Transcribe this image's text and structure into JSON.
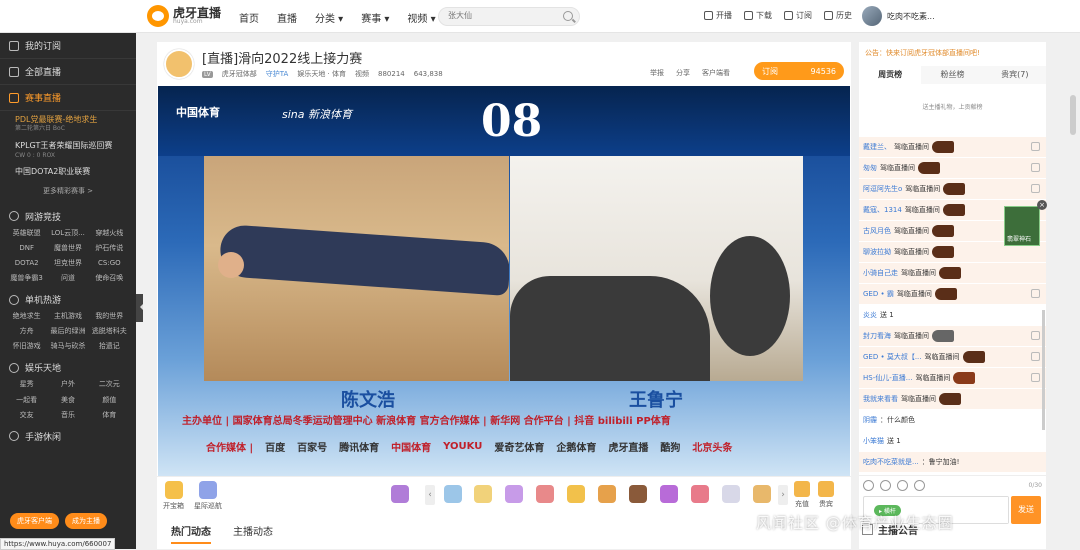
{
  "header": {
    "logo_cn": "虎牙直播",
    "logo_en": "huya.com",
    "nav": [
      "首页",
      "直播",
      "分类 ▾",
      "赛事 ▾",
      "视频 ▾"
    ],
    "search_placeholder": "张大仙",
    "tools": [
      "开播",
      "下载",
      "订阅",
      "历史"
    ],
    "username": "吃肉不吃素..."
  },
  "sidebar": {
    "items": [
      "我的订阅",
      "全部直播",
      "赛事直播"
    ],
    "matches": [
      {
        "title": "PDL党最联赛-绝地求生",
        "sub": "第二轮第六日 BoC"
      },
      {
        "title": "KPLGT王者荣耀国际巡回赛",
        "sub": "CW 0 : 0 ROX"
      },
      {
        "title": "中国DOTA2职业联赛",
        "sub": ""
      }
    ],
    "more": "更多精彩赛事 >",
    "sections": [
      {
        "title": "网游竞技",
        "games": [
          "英雄联盟",
          "LOL云顶...",
          "穿越火线",
          "DNF",
          "魔兽世界",
          "炉石传说",
          "DOTA2",
          "坦克世界",
          "CS:GO",
          "魔兽争霸3",
          "问道",
          "使命召唤"
        ]
      },
      {
        "title": "单机热游",
        "games": [
          "绝地求生",
          "主机游戏",
          "我的世界",
          "方舟",
          "最后的绿洲",
          "逃脱塔科夫",
          "怀旧游戏",
          "骑马与砍杀",
          "拾遗记"
        ]
      },
      {
        "title": "娱乐天地",
        "games": [
          "星秀",
          "户外",
          "二次元",
          "一起看",
          "美食",
          "颜值",
          "交友",
          "音乐",
          "体育"
        ]
      },
      {
        "title": "手游休闲",
        "games": []
      }
    ],
    "buttons": [
      "虎牙客户端",
      "成为主播"
    ],
    "status_url": "https://www.huya.com/660007"
  },
  "room": {
    "title": "[直播]滑向2022线上接力赛",
    "level": "LV",
    "anchor": "虎牙冠体部",
    "anchor_tag": "守护TA",
    "category": "娱乐天地 · 体育",
    "video": "视频",
    "room_id": "880214",
    "viewers": "643,838",
    "actions": [
      "举报",
      "分享",
      "客户端看"
    ],
    "subscribe_label": "订阅",
    "subscribe_count": "94536"
  },
  "stream": {
    "brand1": "中国体育",
    "brand2": "sina 新浪体育",
    "number": "08",
    "name_left": "陈文浩",
    "name_right": "王鲁宁",
    "org_line": "主办单位 | 国家体育总局冬季运动管理中心 新浪体育 官方合作媒体 | 新华网 合作平台 | 抖音 bilibili PP体育",
    "media_line": [
      "合作媒体 |",
      "百度",
      "百家号",
      "腾讯体育",
      "中国体育",
      "YOUKU",
      "爱奇艺体育",
      "企鹅体育",
      "虎牙直播",
      "酷狗",
      "北京头条"
    ]
  },
  "giftbar": {
    "left": [
      "开宝箱",
      "星际巡航"
    ],
    "right": [
      "充值",
      "贵宾"
    ]
  },
  "tabs": [
    "热门动态",
    "主播动态"
  ],
  "chat": {
    "notice": "公告：快来订阅虎牙冠体部直播间吧!",
    "tabs": [
      "周贡榜",
      "粉丝榜",
      "贵宾(7)"
    ],
    "empty": "送主播礼物，上贡献榜",
    "messages": [
      {
        "user": "戴建兰、",
        "text": "驾临直播间"
      },
      {
        "user": "匆匆",
        "text": "驾临直播间"
      },
      {
        "user": "阿逗阿先生o",
        "text": "驾临直播间"
      },
      {
        "user": "戴寇、1314",
        "text": "驾临直播间"
      },
      {
        "user": "古风月色",
        "text": "驾临直播间"
      },
      {
        "user": "聊波拉拗",
        "text": "驾临直播间"
      },
      {
        "user": "小骑自己走",
        "text": "驾临直播间"
      },
      {
        "user": "GED • 霸",
        "text": "驾临直播间"
      },
      {
        "user": "炎炎",
        "text": "送 1"
      },
      {
        "user": "封刀看海",
        "text": "驾临直播间"
      },
      {
        "user": "GED • 莫大叔【...",
        "text": "驾临直播间"
      },
      {
        "user": "HS-仙儿-直播...",
        "text": "驾临直播间"
      },
      {
        "user": "我就来看看",
        "text": "驾临直播间"
      },
      {
        "user": "阴霾",
        "text": "：什么颜色"
      },
      {
        "user": "小笨猫",
        "text": "送 1"
      },
      {
        "user": "吃肉不吃菜就是...",
        "text": "：鲁宁加油!"
      }
    ],
    "count": "0/30",
    "input_label": "▸ 横杆",
    "send": "发送",
    "float_ad": "翡翠神石"
  },
  "announce": "主播公告",
  "watermark": "风闻社区 @体育产业生态圈"
}
